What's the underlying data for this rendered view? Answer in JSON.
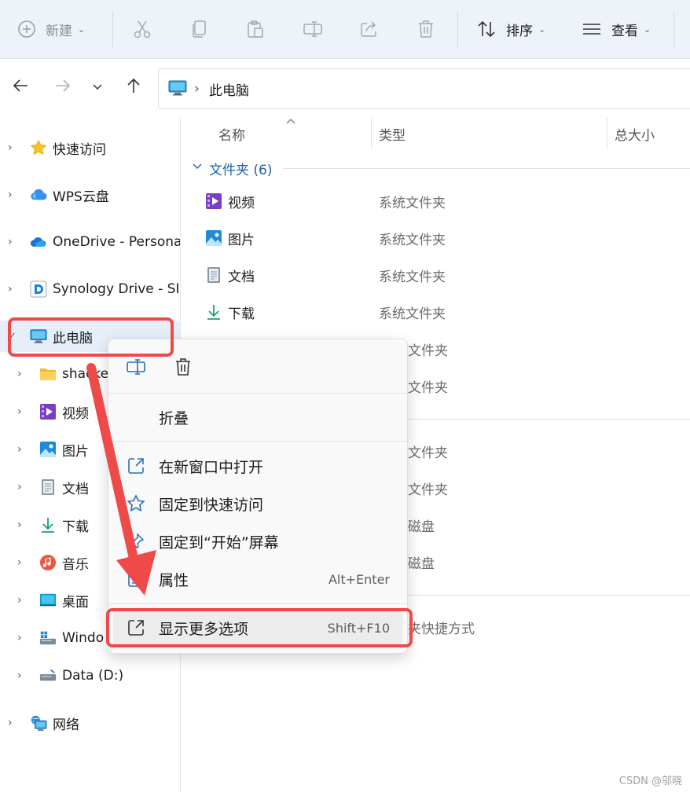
{
  "toolbar": {
    "new_label": "新建",
    "sort_label": "排序",
    "view_label": "查看"
  },
  "address": {
    "path_separator": "›",
    "location": "此电脑"
  },
  "sidebar": {
    "items": [
      {
        "label": "快速访问",
        "icon": "star-icon",
        "expanded": false
      },
      {
        "label": "WPS云盘",
        "icon": "wps-cloud-icon",
        "expanded": false
      },
      {
        "label": "OneDrive - Persona",
        "icon": "onedrive-cloud-icon",
        "expanded": false
      },
      {
        "label": "Synology Drive - SI",
        "icon": "synology-drive-icon",
        "expanded": false
      },
      {
        "label": "此电脑",
        "icon": "monitor-icon",
        "expanded": true,
        "selected": true
      },
      {
        "label": "shacke",
        "icon": "folder-icon",
        "expanded": false
      },
      {
        "label": "视频",
        "icon": "video-folder-icon",
        "expanded": false
      },
      {
        "label": "图片",
        "icon": "pictures-folder-icon",
        "expanded": false
      },
      {
        "label": "文档",
        "icon": "documents-folder-icon",
        "expanded": false
      },
      {
        "label": "下载",
        "icon": "download-icon",
        "expanded": false
      },
      {
        "label": "音乐",
        "icon": "music-icon",
        "expanded": false
      },
      {
        "label": "桌面",
        "icon": "desktop-icon",
        "expanded": false
      },
      {
        "label": "Windo",
        "icon": "windows-drive-icon",
        "expanded": false
      },
      {
        "label": "Data (D:)",
        "icon": "drive-icon",
        "expanded": false
      },
      {
        "label": "网络",
        "icon": "network-icon",
        "expanded": false
      }
    ]
  },
  "columns": {
    "name": "名称",
    "type": "类型",
    "total_size": "总大小"
  },
  "group": {
    "label": "文件夹 (6)"
  },
  "rows": [
    {
      "name": "视频",
      "type": "系统文件夹",
      "icon": "video-folder-icon"
    },
    {
      "name": "图片",
      "type": "系统文件夹",
      "icon": "pictures-folder-icon"
    },
    {
      "name": "文档",
      "type": "系统文件夹",
      "icon": "documents-folder-icon"
    },
    {
      "name": "下载",
      "type": "系统文件夹",
      "icon": "download-icon"
    },
    {
      "name": "",
      "type": "文件夹"
    },
    {
      "name": "",
      "type": "文件夹"
    },
    {
      "name": "",
      "type": "文件夹"
    },
    {
      "name": "",
      "type": "文件夹"
    },
    {
      "name": "",
      "type": "磁盘"
    },
    {
      "name": "",
      "type": "磁盘"
    },
    {
      "name": "",
      "type": "夹快捷方式"
    }
  ],
  "context_menu": {
    "collapse": "折叠",
    "open_new_window": "在新窗口中打开",
    "pin_quick_access": "固定到快速访问",
    "pin_start": "固定到“开始”屏幕",
    "properties": "属性",
    "properties_shortcut": "Alt+Enter",
    "show_more": "显示更多选项",
    "show_more_shortcut": "Shift+F10"
  },
  "watermark": "CSDN @邬晓",
  "colors": {
    "annotation_red": "#ef4a4a",
    "toolbar_bg": "#eef3fa",
    "selection_bg": "#e5eef9",
    "group_blue": "#1f5fa8"
  }
}
